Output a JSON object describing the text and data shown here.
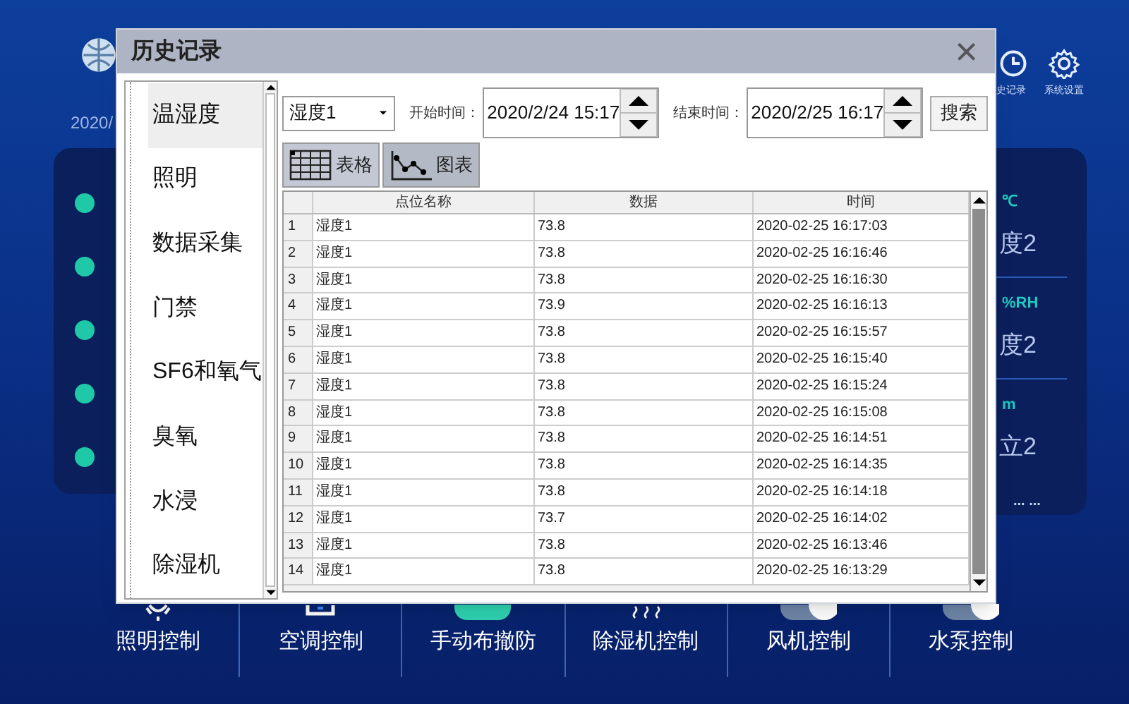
{
  "background": {
    "date": "2020/",
    "top_buttons": [
      {
        "label": "史记录",
        "kind": "clock"
      },
      {
        "label": "系统设置",
        "kind": "gear"
      }
    ],
    "status_dots": [
      {
        "color": "#1fc9a7"
      },
      {
        "color": "#1fc9a7"
      },
      {
        "color": "#1fc9a7"
      },
      {
        "color": "#1fc9a7"
      },
      {
        "color": "#1fc9a7"
      }
    ],
    "readings": [
      {
        "unit": "℃",
        "value": "度2"
      },
      {
        "unit": "%RH",
        "value": "度2"
      },
      {
        "unit": "m",
        "value": "立2"
      }
    ],
    "more": "... ...",
    "bottom_nav": [
      {
        "label": "照明控制",
        "kind": "sun"
      },
      {
        "label": "空调控制",
        "kind": "screen"
      },
      {
        "label": "手动布撤防",
        "kind": "toggle-on"
      },
      {
        "label": "除湿机控制",
        "kind": "waves"
      },
      {
        "label": "风机控制",
        "kind": "toggle-off"
      },
      {
        "label": "水泵控制",
        "kind": "toggle-off"
      }
    ]
  },
  "dialog": {
    "title": "历史记录",
    "close": "×",
    "categories": [
      {
        "label": "温湿度",
        "selected": true
      },
      {
        "label": "照明",
        "selected": false
      },
      {
        "label": "数据采集",
        "selected": false
      },
      {
        "label": "门禁",
        "selected": false
      },
      {
        "label": "SF6和氧气",
        "selected": false
      },
      {
        "label": "臭氧",
        "selected": false
      },
      {
        "label": "水浸",
        "selected": false
      },
      {
        "label": "除湿机",
        "selected": false
      }
    ],
    "point_select": {
      "value": "湿度1"
    },
    "start": {
      "label": "开始时间：",
      "value": "2020/2/24 15:17"
    },
    "end": {
      "label": "结束时间：",
      "value": "2020/2/25 16:17"
    },
    "search_button": "搜索",
    "tabs": [
      {
        "label": "表格",
        "kind": "table",
        "selected": true
      },
      {
        "label": "图表",
        "kind": "chart",
        "selected": false
      }
    ],
    "table": {
      "columns": [
        "",
        "点位名称",
        "数据",
        "时间"
      ],
      "rows": [
        [
          "1",
          "湿度1",
          "73.8",
          "2020-02-25 16:17:03"
        ],
        [
          "2",
          "湿度1",
          "73.8",
          "2020-02-25 16:16:46"
        ],
        [
          "3",
          "湿度1",
          "73.8",
          "2020-02-25 16:16:30"
        ],
        [
          "4",
          "湿度1",
          "73.9",
          "2020-02-25 16:16:13"
        ],
        [
          "5",
          "湿度1",
          "73.8",
          "2020-02-25 16:15:57"
        ],
        [
          "6",
          "湿度1",
          "73.8",
          "2020-02-25 16:15:40"
        ],
        [
          "7",
          "湿度1",
          "73.8",
          "2020-02-25 16:15:24"
        ],
        [
          "8",
          "湿度1",
          "73.8",
          "2020-02-25 16:15:08"
        ],
        [
          "9",
          "湿度1",
          "73.8",
          "2020-02-25 16:14:51"
        ],
        [
          "10",
          "湿度1",
          "73.8",
          "2020-02-25 16:14:35"
        ],
        [
          "11",
          "湿度1",
          "73.8",
          "2020-02-25 16:14:18"
        ],
        [
          "12",
          "湿度1",
          "73.7",
          "2020-02-25 16:14:02"
        ],
        [
          "13",
          "湿度1",
          "73.8",
          "2020-02-25 16:13:46"
        ],
        [
          "14",
          "湿度1",
          "73.8",
          "2020-02-25 16:13:29"
        ]
      ]
    }
  }
}
